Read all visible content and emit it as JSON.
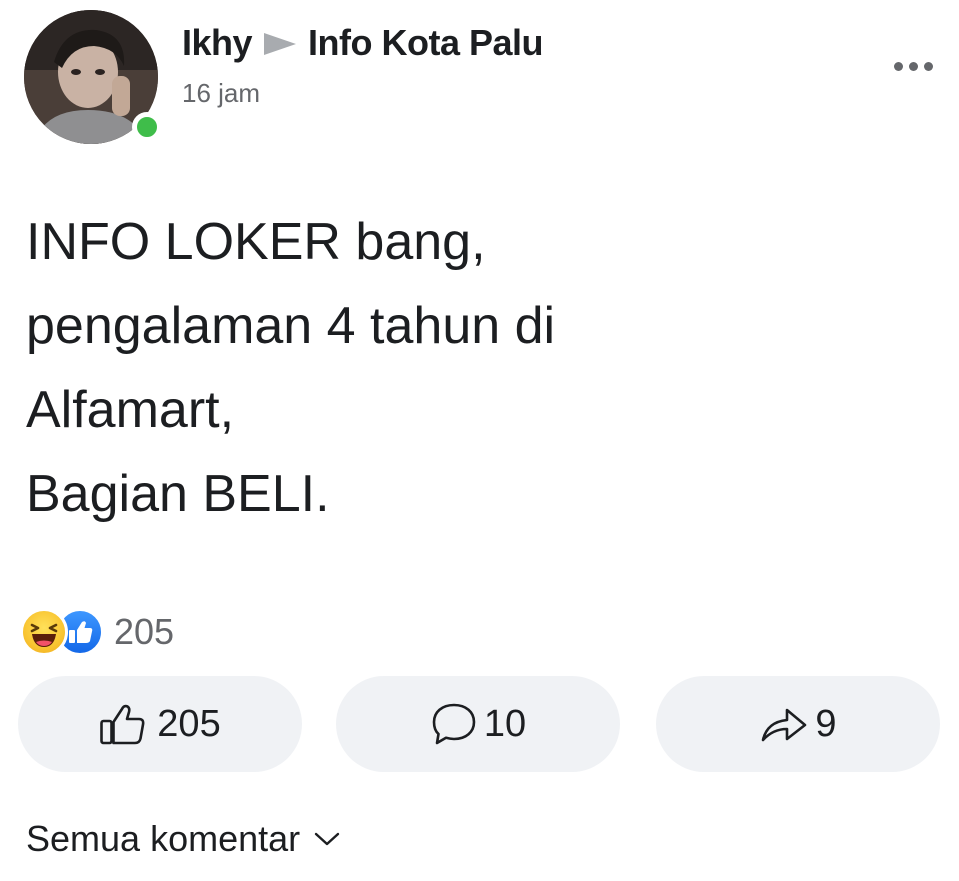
{
  "post": {
    "author": "Ikhy",
    "group": "Info Kota Palu",
    "timestamp": "16 jam",
    "text_lines": [
      "INFO LOKER bang,",
      "pengalaman 4 tahun di",
      "Alfamart,",
      "Bagian BELI."
    ]
  },
  "reactions": {
    "icons": [
      "haha-icon",
      "like-icon"
    ],
    "count": "205"
  },
  "actions": {
    "like_count": "205",
    "comment_count": "10",
    "share_count": "9"
  },
  "footer": {
    "all_comments_label": "Semua komentar"
  },
  "colors": {
    "online": "#3fbd4a",
    "like_blue": "#1877f2",
    "haha_yellow": "#f9c532",
    "button_bg": "#f0f2f5",
    "secondary_text": "#65676b"
  }
}
